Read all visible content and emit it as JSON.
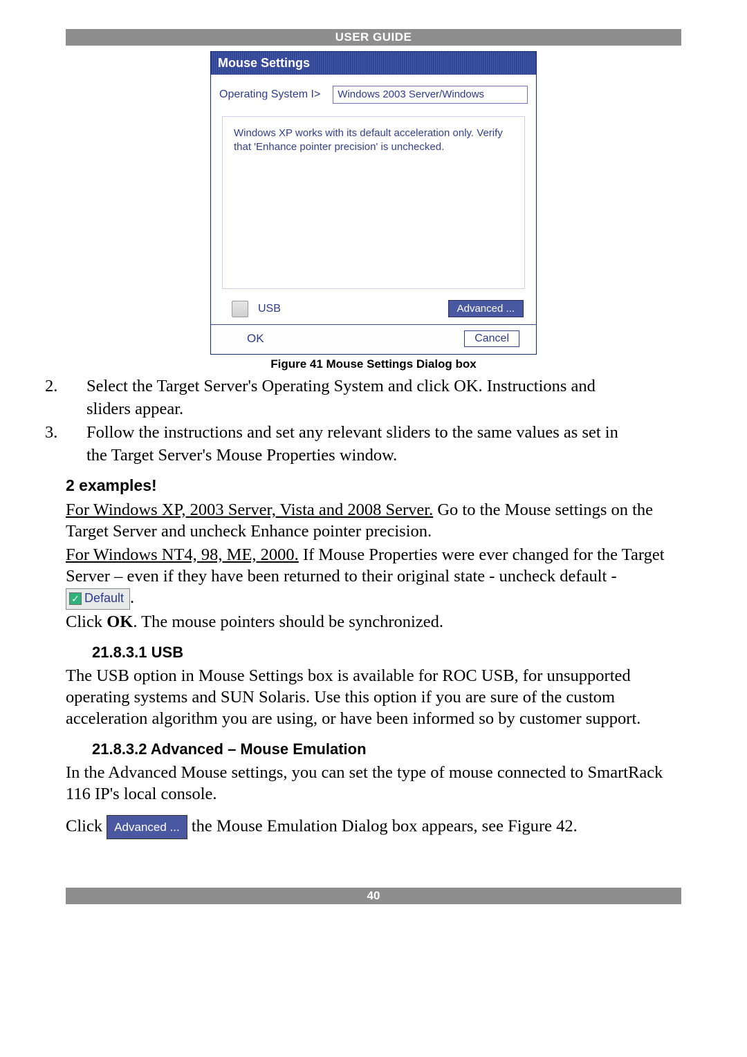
{
  "header": {
    "title": "USER GUIDE"
  },
  "dialog": {
    "title": "Mouse Settings",
    "os_label": "Operating System I>",
    "os_value": "Windows 2003 Server/Windows",
    "message": "Windows XP works with its default acceleration only. Verify that 'Enhance pointer precision' is unchecked.",
    "usb_label": "USB",
    "advanced_label": "Advanced ...",
    "ok_label": "OK",
    "cancel_label": "Cancel"
  },
  "caption": "Figure 41 Mouse Settings Dialog box",
  "steps": {
    "s2a": "Select the Target Server's Operating System and click OK. Instructions and",
    "s2b": "sliders appear.",
    "s3a": "Follow the instructions and set any relevant sliders to the same values as set in",
    "s3b": "the Target Server's Mouse Properties window."
  },
  "examples": {
    "heading": "2 examples!",
    "winxp_u": "For Windows XP, 2003 Server, Vista and 2008 Server.",
    "winxp_rest": " Go to the Mouse settings on the Target Server and uncheck Enhance pointer precision.",
    "winnt_u": "For Windows NT4, 98, ME, 2000.",
    "winnt_rest": " If Mouse Properties were ever changed for the Target Server – even if they have been returned to their original state - uncheck default - ",
    "default_chip": "Default",
    "period": ".",
    "click_ok_pre": "Click ",
    "click_ok_bold": "OK",
    "click_ok_post": ". The mouse pointers should be synchronized."
  },
  "usb": {
    "heading": "21.8.3.1 USB",
    "body": "The USB option in Mouse Settings box is available for ROC USB, for unsupported operating systems and SUN Solaris. Use this option if you are sure of the custom acceleration algorithm you are using, or have been informed so by customer support."
  },
  "adv": {
    "heading": "21.8.3.2 Advanced – Mouse Emulation",
    "body": "In the Advanced Mouse settings, you can set the type of mouse connected to SmartRack 116 IP's local console.",
    "click_pre": "Click ",
    "chip": "Advanced ...",
    "click_post": " the Mouse Emulation Dialog box appears, see Figure 42."
  },
  "footer": {
    "page": "40"
  }
}
